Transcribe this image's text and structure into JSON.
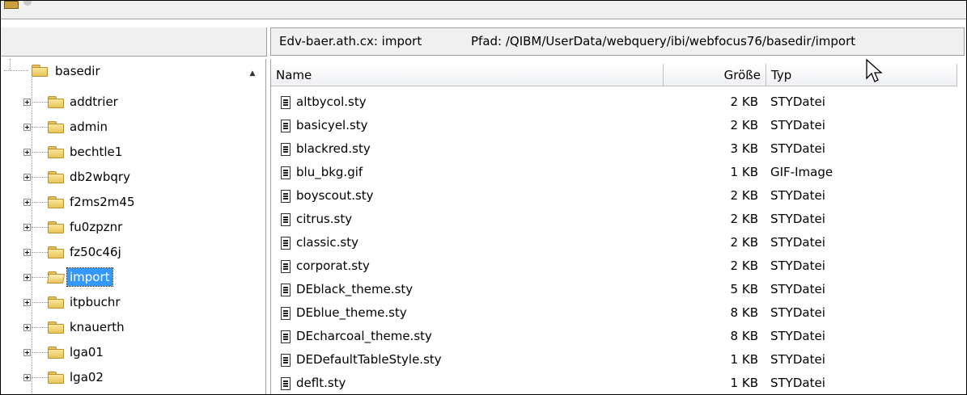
{
  "path_bar": {
    "host_text": "Edv-baer.ath.cx:  import",
    "path_text": "Pfad: /QIBM/UserData/webquery/ibi/webfocus76/basedir/import"
  },
  "tree": {
    "root": {
      "label": "basedir",
      "icon": "folder-icon"
    },
    "children": [
      {
        "label": "addtrier",
        "icon": "folder-icon",
        "selected": false
      },
      {
        "label": "admin",
        "icon": "folder-icon",
        "selected": false
      },
      {
        "label": "bechtle1",
        "icon": "folder-icon",
        "selected": false
      },
      {
        "label": "db2wbqry",
        "icon": "folder-icon",
        "selected": false
      },
      {
        "label": "f2ms2m45",
        "icon": "folder-icon",
        "selected": false
      },
      {
        "label": "fu0zpznr",
        "icon": "folder-icon",
        "selected": false
      },
      {
        "label": "fz50c46j",
        "icon": "folder-icon",
        "selected": false
      },
      {
        "label": "import",
        "icon": "open-folder-icon",
        "selected": true
      },
      {
        "label": "itpbuchr",
        "icon": "folder-icon",
        "selected": false
      },
      {
        "label": "knauerth",
        "icon": "folder-icon",
        "selected": false
      },
      {
        "label": "lga01",
        "icon": "folder-icon",
        "selected": false
      },
      {
        "label": "lga02",
        "icon": "folder-icon",
        "selected": false
      }
    ]
  },
  "list": {
    "columns": {
      "name": "Name",
      "size": "Größe",
      "type": "Typ"
    },
    "rows": [
      {
        "name": "altbycol.sty",
        "size": "2 KB",
        "type": "STYDatei"
      },
      {
        "name": "basicyel.sty",
        "size": "2 KB",
        "type": "STYDatei"
      },
      {
        "name": "blackred.sty",
        "size": "3 KB",
        "type": "STYDatei"
      },
      {
        "name": "blu_bkg.gif",
        "size": "1 KB",
        "type": "GIF-Image"
      },
      {
        "name": "boyscout.sty",
        "size": "2 KB",
        "type": "STYDatei"
      },
      {
        "name": "citrus.sty",
        "size": "2 KB",
        "type": "STYDatei"
      },
      {
        "name": "classic.sty",
        "size": "2 KB",
        "type": "STYDatei"
      },
      {
        "name": "corporat.sty",
        "size": "2 KB",
        "type": "STYDatei"
      },
      {
        "name": "DEblack_theme.sty",
        "size": "5 KB",
        "type": "STYDatei"
      },
      {
        "name": "DEblue_theme.sty",
        "size": "8 KB",
        "type": "STYDatei"
      },
      {
        "name": "DEcharcoal_theme.sty",
        "size": "8 KB",
        "type": "STYDatei"
      },
      {
        "name": "DEDefaultTableStyle.sty",
        "size": "1 KB",
        "type": "STYDatei"
      },
      {
        "name": "deflt.sty",
        "size": "1 KB",
        "type": "STYDatei"
      }
    ]
  },
  "colors": {
    "selection": "#3399ff",
    "folder": "#e8c558"
  }
}
